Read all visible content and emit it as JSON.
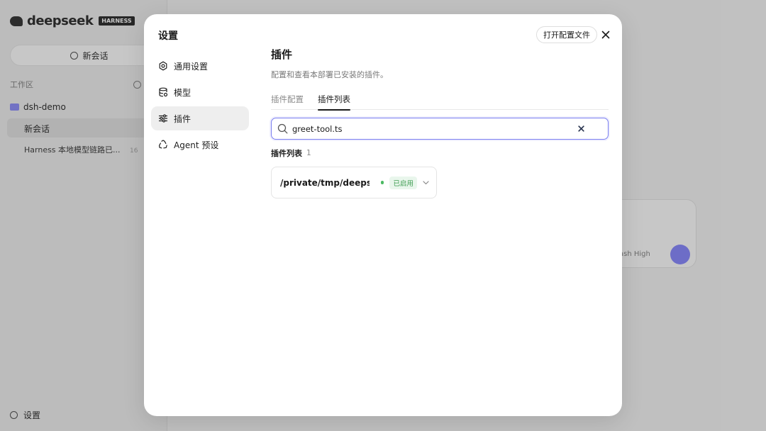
{
  "background": {
    "logo_text": "deepseek",
    "logo_tag": "HARNESS",
    "new_chat_label": "新会话",
    "section_label": "工作区",
    "folder_name": "dsh-demo",
    "chat_active": "新会话",
    "chat_second": "Harness 本地模型链路已...",
    "chat_second_meta": "16",
    "settings_label": "设置",
    "composer_model": "ash High"
  },
  "modal": {
    "title": "设置",
    "open_config_label": "打开配置文件",
    "close_icon": "close-icon"
  },
  "nav": {
    "items": [
      {
        "label": "通用设置",
        "icon": "gear-icon",
        "active": false
      },
      {
        "label": "模型",
        "icon": "database-icon",
        "active": false
      },
      {
        "label": "插件",
        "icon": "sliders-icon",
        "active": true
      },
      {
        "label": "Agent 预设",
        "icon": "recycle-icon",
        "active": false
      }
    ]
  },
  "plugins_page": {
    "heading": "插件",
    "description": "配置和查看本部署已安装的插件。",
    "tabs": [
      {
        "label": "插件配置",
        "active": false
      },
      {
        "label": "插件列表",
        "active": true
      }
    ],
    "search": {
      "value": "greet-tool.ts",
      "placeholder": ""
    },
    "list_label": "插件列表",
    "list_count": "1",
    "items": [
      {
        "name": "/private/tmp/deepse...",
        "status": "已启用",
        "status_color": "#4cb963"
      }
    ]
  },
  "colors": {
    "accent": "#7a7ef0",
    "enabled": "#4cb963"
  }
}
